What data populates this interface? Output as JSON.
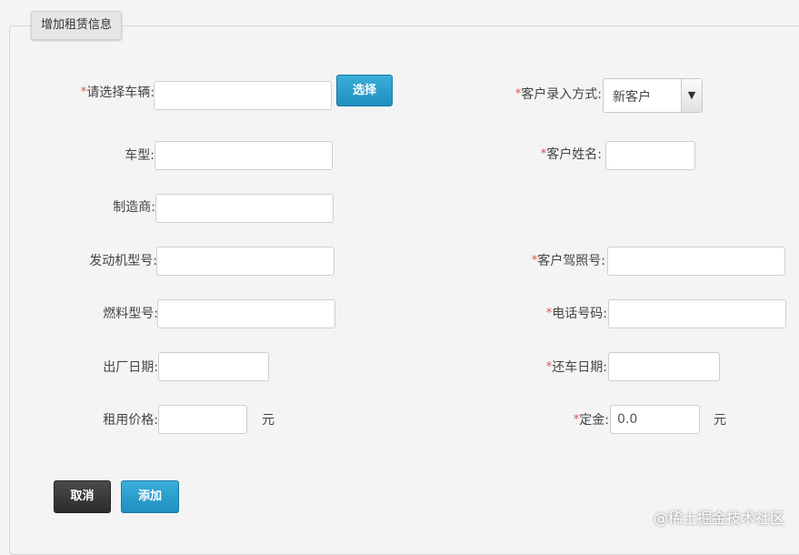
{
  "legend": "增加租赁信息",
  "required_mark": "*",
  "left": {
    "vehicle": {
      "label": "请选择车辆:",
      "value": ""
    },
    "select_button": "选择",
    "car_type": {
      "label": "车型:",
      "value": ""
    },
    "manufacturer": {
      "label": "制造商:",
      "value": ""
    },
    "engine_model": {
      "label": "发动机型号:",
      "value": ""
    },
    "fuel_model": {
      "label": "燃料型号:",
      "value": ""
    },
    "factory_date": {
      "label": "出厂日期:",
      "value": ""
    },
    "rent_price": {
      "label": "租用价格:",
      "value": "",
      "unit": "元"
    }
  },
  "right": {
    "entry_mode": {
      "label": "客户录入方式:",
      "value": "新客户"
    },
    "customer_name": {
      "label": "客户姓名:",
      "value": ""
    },
    "license": {
      "label": "客户驾照号:",
      "value": ""
    },
    "phone": {
      "label": "电话号码:",
      "value": ""
    },
    "return_date": {
      "label": "还车日期:",
      "value": ""
    },
    "deposit": {
      "label": "定金:",
      "value": "0.0",
      "unit": "元"
    }
  },
  "buttons": {
    "cancel": "取消",
    "add": "添加"
  },
  "watermark": "@稀土掘金技术社区",
  "colors": {
    "accent": "#2196c8",
    "required": "#d9534f",
    "dark_button": "#333333"
  }
}
